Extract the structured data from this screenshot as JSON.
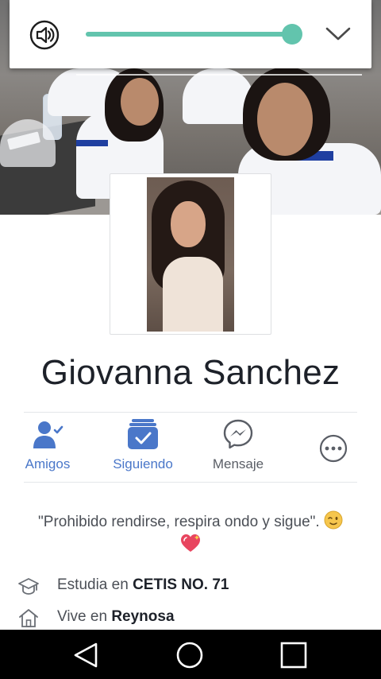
{
  "volume_panel": {
    "level_percent": 100,
    "accent_color": "#62c4ad",
    "speaker_icon": "speaker-icon",
    "collapse_icon": "chevron-down-icon"
  },
  "profile": {
    "name": "Giovanna Sanchez"
  },
  "actions": [
    {
      "label": "Amigos",
      "icon": "friends-check-icon",
      "color": "#4a77c9"
    },
    {
      "label": "Siguiendo",
      "icon": "following-check-icon",
      "color": "#4a77c9"
    },
    {
      "label": "Mensaje",
      "icon": "messenger-icon",
      "color": "#5a5e66"
    },
    {
      "label": "",
      "icon": "more-options-icon",
      "color": "#5a5e66"
    }
  ],
  "bio": {
    "text": "\"Prohibido rendirse, respira ondo y sigue\".",
    "emojis": [
      "wink-emoji",
      "sparkling-heart-emoji"
    ]
  },
  "intro": [
    {
      "prefix": "Estudia en ",
      "value": "CETIS NO. 71",
      "icon": "graduation-cap-icon"
    },
    {
      "prefix": "Vive en ",
      "value": "Reynosa",
      "icon": "home-icon"
    }
  ],
  "navbar": {
    "buttons": [
      "back-icon",
      "home-circle-icon",
      "recents-square-icon"
    ]
  }
}
